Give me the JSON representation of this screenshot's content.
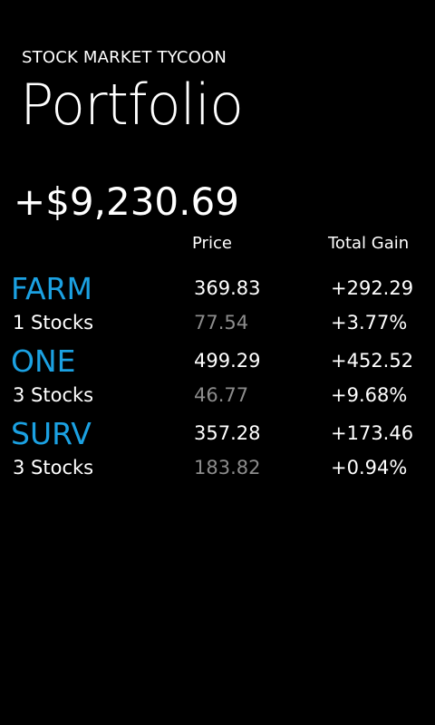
{
  "app": {
    "title": "STOCK MARKET TYCOON"
  },
  "page": {
    "title": "Portfolio"
  },
  "portfolio": {
    "total_gain": "+$9,230.69"
  },
  "columns": {
    "price": "Price",
    "total_gain": "Total Gain"
  },
  "colors": {
    "accent": "#1ba1e2",
    "muted": "#8c8c8c",
    "background": "#000000",
    "text": "#ffffff"
  },
  "stocks": [
    {
      "symbol": "FARM",
      "shares": "1 Stocks",
      "price": "369.83",
      "cost": "77.54",
      "gain": "+292.29",
      "gain_pct": "+3.77%"
    },
    {
      "symbol": "ONE",
      "shares": "3 Stocks",
      "price": "499.29",
      "cost": "46.77",
      "gain": "+452.52",
      "gain_pct": "+9.68%"
    },
    {
      "symbol": "SURV",
      "shares": "3 Stocks",
      "price": "357.28",
      "cost": "183.82",
      "gain": "+173.46",
      "gain_pct": "+0.94%"
    }
  ]
}
